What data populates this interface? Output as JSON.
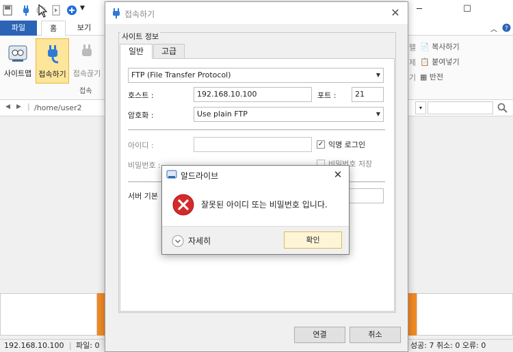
{
  "app": {
    "window_controls": {
      "minimize": "─",
      "maximize": "☐"
    },
    "ribbon_tabs": [
      "파일",
      "홈",
      "보기"
    ],
    "ribbon_buttons": [
      "사이트맵",
      "접속하기",
      "접속끊기"
    ],
    "ribbon_group_label": "접속",
    "clipboard_actions": [
      "복사하기",
      "붙여넣기",
      "반전"
    ],
    "partial_left_chars": [
      "팰",
      "제",
      "기"
    ],
    "path": "/home/user2",
    "status": {
      "host": "192.168.10.100",
      "files": "파일: 0",
      "summary": "성공: 7 취소: 0 오류: 0"
    }
  },
  "connect_dialog": {
    "title": "접속하기",
    "section": "사이트 정보",
    "tabs": [
      "일반",
      "고급"
    ],
    "protocol": "FTP (File Transfer Protocol)",
    "host_label": "호스트 :",
    "host_value": "192.168.10.100",
    "port_label": "포트 :",
    "port_value": "21",
    "encryption_label": "암호화 :",
    "encryption_value": "Use plain FTP",
    "id_label": "아이디 :",
    "id_value": "",
    "anonymous_label": "익명 로그인",
    "anonymous_checked": true,
    "password_label": "비밀번호 :",
    "save_password_label": "비밀번호 저장",
    "server_default_label": "서버 기본",
    "connect_button": "연결",
    "cancel_button": "취소"
  },
  "error_dialog": {
    "title": "알드라이브",
    "message": "잘못된 아이디 또는 비밀번호 입니다.",
    "details_label": "자세히",
    "ok_button": "확인",
    "icon": "error-icon"
  },
  "colors": {
    "file_tab": "#2b64b6",
    "active_button": "#fde59a",
    "error_red": "#d42a2a",
    "orange": "#f08a24"
  }
}
